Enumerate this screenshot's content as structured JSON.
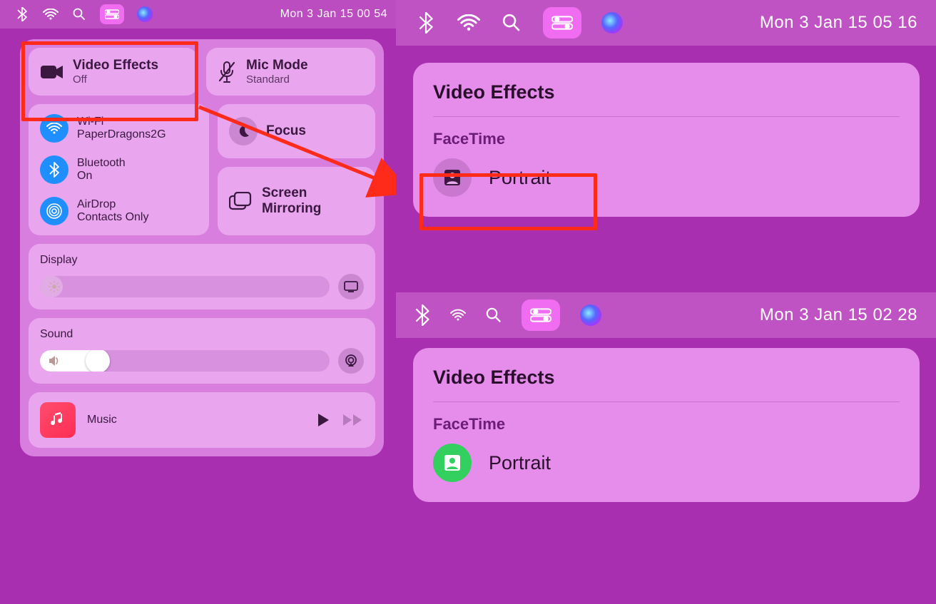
{
  "left": {
    "menubar": {
      "date": "Mon 3 Jan  15 00 54"
    },
    "tiles": {
      "video_effects": {
        "title": "Video Effects",
        "sub": "Off"
      },
      "mic_mode": {
        "title": "Mic Mode",
        "sub": "Standard"
      },
      "wifi": {
        "title": "Wi-Fi",
        "sub": "PaperDragons2G"
      },
      "bluetooth": {
        "title": "Bluetooth",
        "sub": "On"
      },
      "airdrop": {
        "title": "AirDrop",
        "sub": "Contacts Only"
      },
      "focus": {
        "title": "Focus"
      },
      "screen_mirroring": {
        "title": "Screen",
        "sub": "Mirroring"
      },
      "display": {
        "title": "Display"
      },
      "sound": {
        "title": "Sound"
      },
      "music": {
        "title": "Music"
      }
    }
  },
  "right_top": {
    "menubar": {
      "date": "Mon 3 Jan  15 05 16"
    },
    "panel": {
      "title": "Video Effects",
      "app": "FaceTime",
      "option": "Portrait",
      "option_active": false
    }
  },
  "right_bottom": {
    "menubar": {
      "date": "Mon 3 Jan  15 02 28"
    },
    "panel": {
      "title": "Video Effects",
      "app": "FaceTime",
      "option": "Portrait",
      "option_active": true
    }
  }
}
